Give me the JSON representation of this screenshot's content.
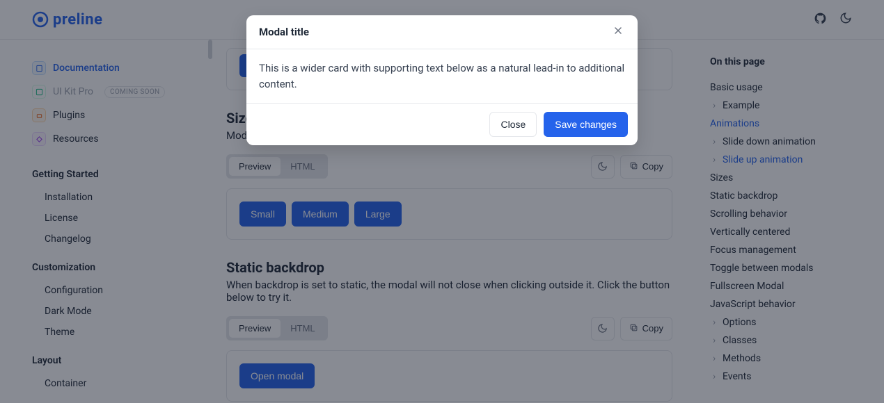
{
  "header": {
    "brand": "preline"
  },
  "sidebar": {
    "top": [
      {
        "label": "Documentation",
        "active": true
      },
      {
        "label": "UI Kit Pro",
        "coming_soon": "COMING SOON"
      },
      {
        "label": "Plugins"
      },
      {
        "label": "Resources"
      }
    ],
    "sections": [
      {
        "title": "Getting Started",
        "items": [
          "Installation",
          "License",
          "Changelog"
        ]
      },
      {
        "title": "Customization",
        "items": [
          "Configuration",
          "Dark Mode",
          "Theme"
        ]
      },
      {
        "title": "Layout",
        "items": [
          "Container"
        ]
      }
    ]
  },
  "main": {
    "sizes": {
      "heading": "Sizes",
      "desc": "Modals have four optional sizes.",
      "tabs": {
        "preview": "Preview",
        "html": "HTML"
      },
      "copy": "Copy",
      "buttons": [
        "Small",
        "Medium",
        "Large"
      ]
    },
    "static": {
      "heading": "Static backdrop",
      "desc": "When backdrop is set to static, the modal will not close when clicking outside it. Click the button below to try it.",
      "tabs": {
        "preview": "Preview",
        "html": "HTML"
      },
      "copy": "Copy",
      "open": "Open modal"
    }
  },
  "toc": {
    "title": "On this page",
    "items": [
      {
        "label": "Basic usage"
      },
      {
        "label": "Example",
        "sub": true
      },
      {
        "label": "Animations",
        "active": true
      },
      {
        "label": "Slide down animation",
        "sub": true
      },
      {
        "label": "Slide up animation",
        "sub": true,
        "active": true
      },
      {
        "label": "Sizes"
      },
      {
        "label": "Static backdrop"
      },
      {
        "label": "Scrolling behavior"
      },
      {
        "label": "Vertically centered"
      },
      {
        "label": "Focus management"
      },
      {
        "label": "Toggle between modals"
      },
      {
        "label": "Fullscreen Modal"
      },
      {
        "label": "JavaScript behavior"
      },
      {
        "label": "Options",
        "sub": true
      },
      {
        "label": "Classes",
        "sub": true
      },
      {
        "label": "Methods",
        "sub": true
      },
      {
        "label": "Events",
        "sub": true
      }
    ]
  },
  "modal": {
    "title": "Modal title",
    "body": "This is a wider card with supporting text below as a natural lead-in to additional content.",
    "close": "Close",
    "save": "Save changes"
  }
}
